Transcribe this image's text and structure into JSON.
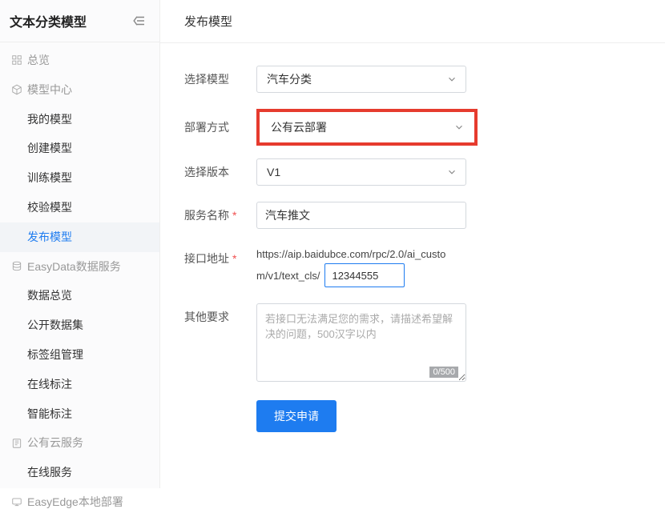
{
  "sidebar": {
    "title": "文本分类模型",
    "items": [
      {
        "label": "总览",
        "kind": "section",
        "icon": "grid"
      },
      {
        "label": "模型中心",
        "kind": "section",
        "icon": "cube"
      },
      {
        "label": "我的模型",
        "kind": "child"
      },
      {
        "label": "创建模型",
        "kind": "child"
      },
      {
        "label": "训练模型",
        "kind": "child"
      },
      {
        "label": "校验模型",
        "kind": "child"
      },
      {
        "label": "发布模型",
        "kind": "child",
        "active": true
      },
      {
        "label": "EasyData数据服务",
        "kind": "section",
        "icon": "data"
      },
      {
        "label": "数据总览",
        "kind": "child"
      },
      {
        "label": "公开数据集",
        "kind": "child"
      },
      {
        "label": "标签组管理",
        "kind": "child"
      },
      {
        "label": "在线标注",
        "kind": "child"
      },
      {
        "label": "智能标注",
        "kind": "child"
      },
      {
        "label": "公有云服务",
        "kind": "section",
        "icon": "cloud"
      },
      {
        "label": "在线服务",
        "kind": "child"
      },
      {
        "label": "EasyEdge本地部署",
        "kind": "section",
        "icon": "deploy"
      }
    ]
  },
  "page": {
    "title": "发布模型"
  },
  "form": {
    "select_model": {
      "label": "选择模型",
      "value": "汽车分类"
    },
    "deploy_mode": {
      "label": "部署方式",
      "value": "公有云部署"
    },
    "select_version": {
      "label": "选择版本",
      "value": "V1"
    },
    "service_name": {
      "label": "服务名称",
      "value": "汽车推文"
    },
    "api_url": {
      "label": "接口地址",
      "prefix_line1": "https://aip.baidubce.com/rpc/2.0/ai_custo",
      "prefix_line2": "m/v1/text_cls/",
      "value": "12344555"
    },
    "other": {
      "label": "其他要求",
      "placeholder": "若接口无法满足您的需求，请描述希望解决的问题，500汉字以内",
      "charcount": "0/500"
    },
    "submit_label": "提交申请"
  }
}
